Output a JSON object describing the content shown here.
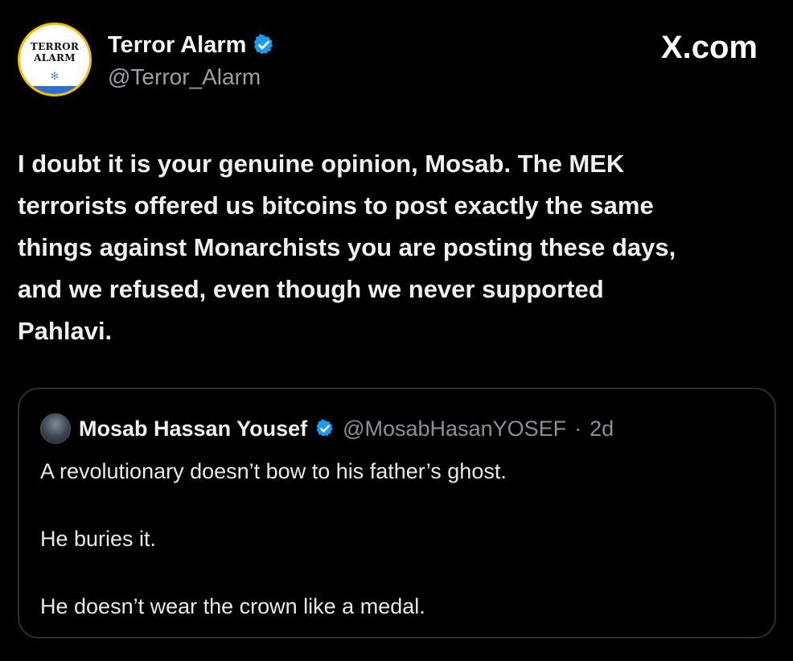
{
  "author": {
    "display_name": "Terror Alarm",
    "handle": "@Terror_Alarm",
    "avatar_text": "TERROR ALARM",
    "verified_icon": "verified-badge-icon"
  },
  "source_label": "X.com",
  "tweet": {
    "text": "I doubt it is your genuine opinion, Mosab. The MEK\nterrorists offered us bitcoins to post exactly the same\nthings against Monarchists you are posting these days,\nand we refused, even though we never supported\nPahlavi."
  },
  "quoted_tweet": {
    "display_name": "Mosab Hassan Yousef",
    "handle": "@MosabHasanYOSEF",
    "separator": "·",
    "time": "2d",
    "lines": [
      "A revolutionary doesn’t bow to his father’s ghost.",
      "He buries it.",
      "He doesn’t wear the crown like a medal."
    ]
  },
  "colors": {
    "background": "#000000",
    "verified_blue": "#1d9bf0",
    "secondary_text": "#8b9096",
    "card_border": "#2b2f33"
  }
}
